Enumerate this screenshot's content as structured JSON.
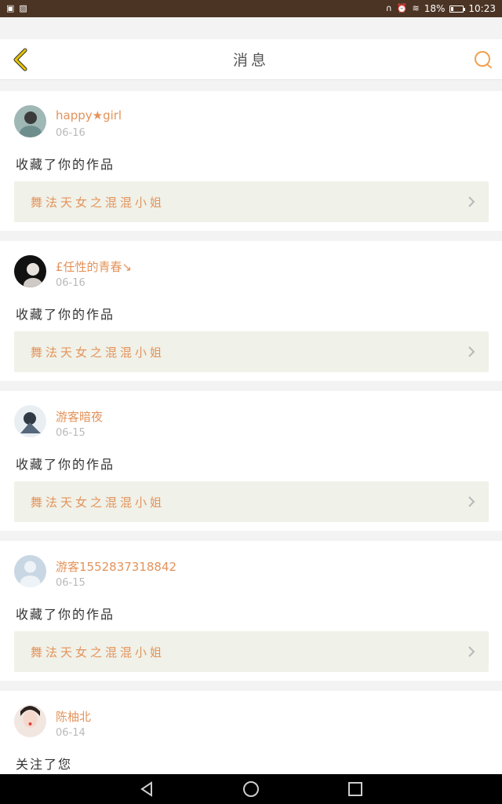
{
  "status": {
    "battery": "18%",
    "time": "10:23",
    "battery_level": 0.18
  },
  "header": {
    "title": "消息"
  },
  "colors": {
    "accent": "#e3935b",
    "back_icon": "#e6c200",
    "status_bg": "#4b3424"
  },
  "feed": [
    {
      "username": "happy★girl",
      "date": "06-16",
      "action": "收藏了你的作品",
      "work": "舞法天女之混混小姐",
      "avatar_color": "#7c9a9b"
    },
    {
      "username": "£任性的青春↘",
      "date": "06-16",
      "action": "收藏了你的作品",
      "work": "舞法天女之混混小姐",
      "avatar_color": "#1d1d1d"
    },
    {
      "username": "游客暗夜",
      "date": "06-15",
      "action": "收藏了你的作品",
      "work": "舞法天女之混混小姐",
      "avatar_color": "#5a6470"
    },
    {
      "username": "游客1552837318842",
      "date": "06-15",
      "action": "收藏了你的作品",
      "work": "舞法天女之混混小姐",
      "avatar_color": "#c9d7e4"
    },
    {
      "username": "陈柚北",
      "date": "06-14",
      "action": "关注了您",
      "avatar_color": "#d9b3a8"
    }
  ]
}
